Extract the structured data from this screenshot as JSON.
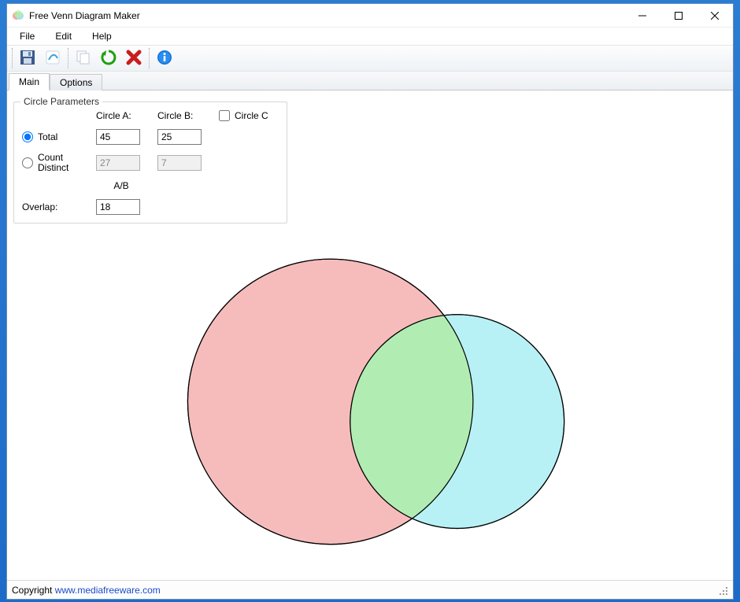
{
  "window": {
    "title": "Free Venn Diagram Maker"
  },
  "menu": {
    "file": "File",
    "edit": "Edit",
    "help": "Help"
  },
  "tabs": {
    "main": "Main",
    "options": "Options"
  },
  "group": {
    "legend": "Circle Parameters",
    "col_a": "Circle A:",
    "col_b": "Circle B:",
    "circle_c_label": "Circle C",
    "total_label": "Total",
    "count_distinct_label": "Count Distinct",
    "overlap_label": "Overlap:",
    "ab_label": "A/B",
    "total_a": "45",
    "total_b": "25",
    "distinct_a": "27",
    "distinct_b": "7",
    "overlap_ab": "18"
  },
  "footer": {
    "copyright_prefix": "Copyright ",
    "copyright_link": "www.mediafreeware.com"
  },
  "chart_data": {
    "type": "venn",
    "sets": [
      {
        "name": "Circle A",
        "total": 45,
        "distinct": 27,
        "color": "#f5b5b5"
      },
      {
        "name": "Circle B",
        "total": 25,
        "distinct": 7,
        "color": "#b5f0f5"
      }
    ],
    "overlaps": [
      {
        "sets": [
          "Circle A",
          "Circle B"
        ],
        "value": 18,
        "color": "#b0edb0"
      }
    ],
    "circle_c_enabled": false
  }
}
